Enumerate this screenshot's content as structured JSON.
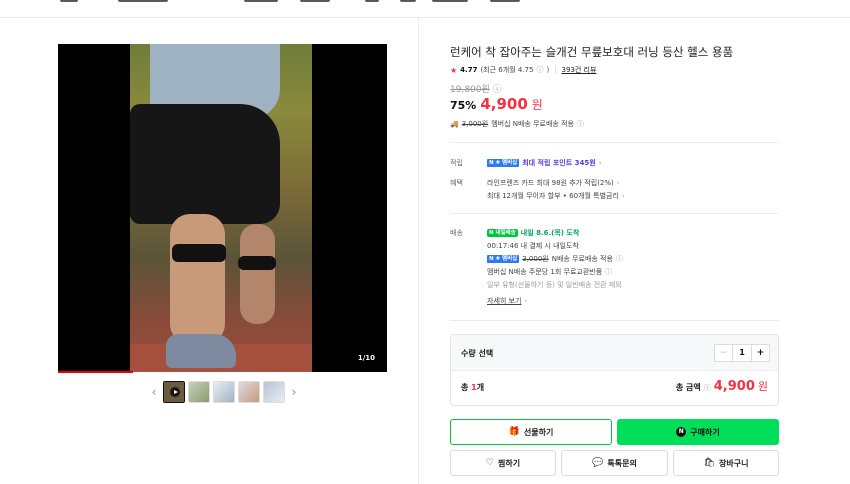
{
  "product": {
    "title": "런케어 착 잡아주는 슬개건 무릎보호대 러닝 등산 헬스 용품",
    "rating": "4.77",
    "rating_recent": "(최근 6개월 4.75",
    "rating_info_glyph": "ⓘ",
    "rating_close": ")",
    "review_link": "393건 리뷰",
    "original_price": "19,800원",
    "discount_pct": "75%",
    "sale_price": "4,900",
    "currency": "원",
    "shipping_old": "3,000원",
    "shipping_note": "멤버십 N배송 무료배송 적용"
  },
  "media": {
    "counter": "1/10",
    "prev_arrow": "‹",
    "next_arrow": "›",
    "thumb_colors": [
      "#6b5a40",
      "#c9d0c0",
      "#e9eef5",
      "#d9dde4",
      "#b8c4d4"
    ]
  },
  "points": {
    "label_line1": "적립",
    "label_line2": "혜택",
    "npay_badge": "N ✚ 멤버십",
    "points_text": "최대 적립 포인트 345원",
    "chevron": "›",
    "card_text": "라인프렌즈 카드 최대 98원 추가 적립(2%)",
    "installment_text": "최대 12개월 무이자 할부 • 60개월 특별금리"
  },
  "delivery": {
    "label": "배송",
    "badge": "N 내일배송",
    "arrival": "내일 8.6.(목) 도착",
    "cutoff": "00:17:46  내 결제 시 내일도착",
    "npay_badge": "N ✚ 멤버십",
    "free_old": "3,000원",
    "free_text": "N배송 무료배송 적용",
    "exchange": "멤버십 N배송 주문당 1회 무료교환반품",
    "note": "일부 유형(선물하기 등) 및 일반배송 전환 제외",
    "more_link": "자세히 보기"
  },
  "quantity": {
    "label": "수량 선택",
    "minus": "−",
    "value": "1",
    "plus": "+",
    "total_prefix": "총 ",
    "total_count": "1",
    "total_suffix": "개",
    "sum_label": "총 금액",
    "sum_amount": "4,900",
    "sum_won": "원"
  },
  "buttons": {
    "gift": "선물하기",
    "buy": "구매하기",
    "buy_badge": "N",
    "wish": "찜하기",
    "talk": "톡톡문의",
    "cart": "장바구니"
  },
  "icons": {
    "star": "★",
    "gift": "🎁",
    "heart": "♡",
    "chat": "💬",
    "cart": "🛍",
    "truck": "🚚",
    "info": "ⓘ"
  },
  "colors": {
    "accent_red": "#f43142",
    "naver_green": "#00c73c",
    "buy_green": "#00de5a",
    "points_purple": "#5d3ad6"
  }
}
